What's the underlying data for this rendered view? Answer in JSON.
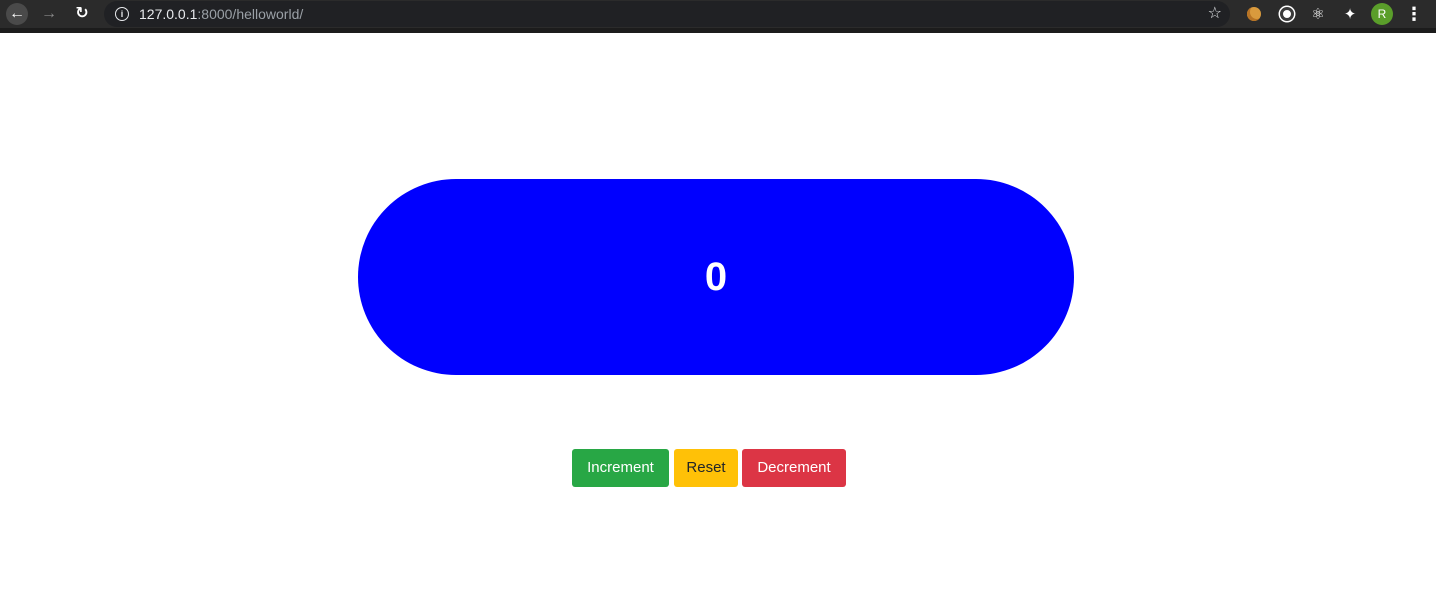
{
  "browser": {
    "url_host": "127.0.0.1",
    "url_rest": ":8000/helloworld/",
    "profile_initial": "R",
    "icons": {
      "back": "arrow-left",
      "forward": "arrow-right",
      "reload": "reload",
      "site_info": "info",
      "bookmark": "star",
      "extensions": [
        "cookie",
        "circle",
        "react",
        "puzzle"
      ],
      "menu": "vertical-dots"
    }
  },
  "counter": {
    "value": "0",
    "display_color": "#0000ff"
  },
  "buttons": {
    "increment": "Increment",
    "reset": "Reset",
    "decrement": "Decrement",
    "colors": {
      "increment": "#28a745",
      "reset": "#ffc107",
      "decrement": "#dc3545"
    }
  }
}
